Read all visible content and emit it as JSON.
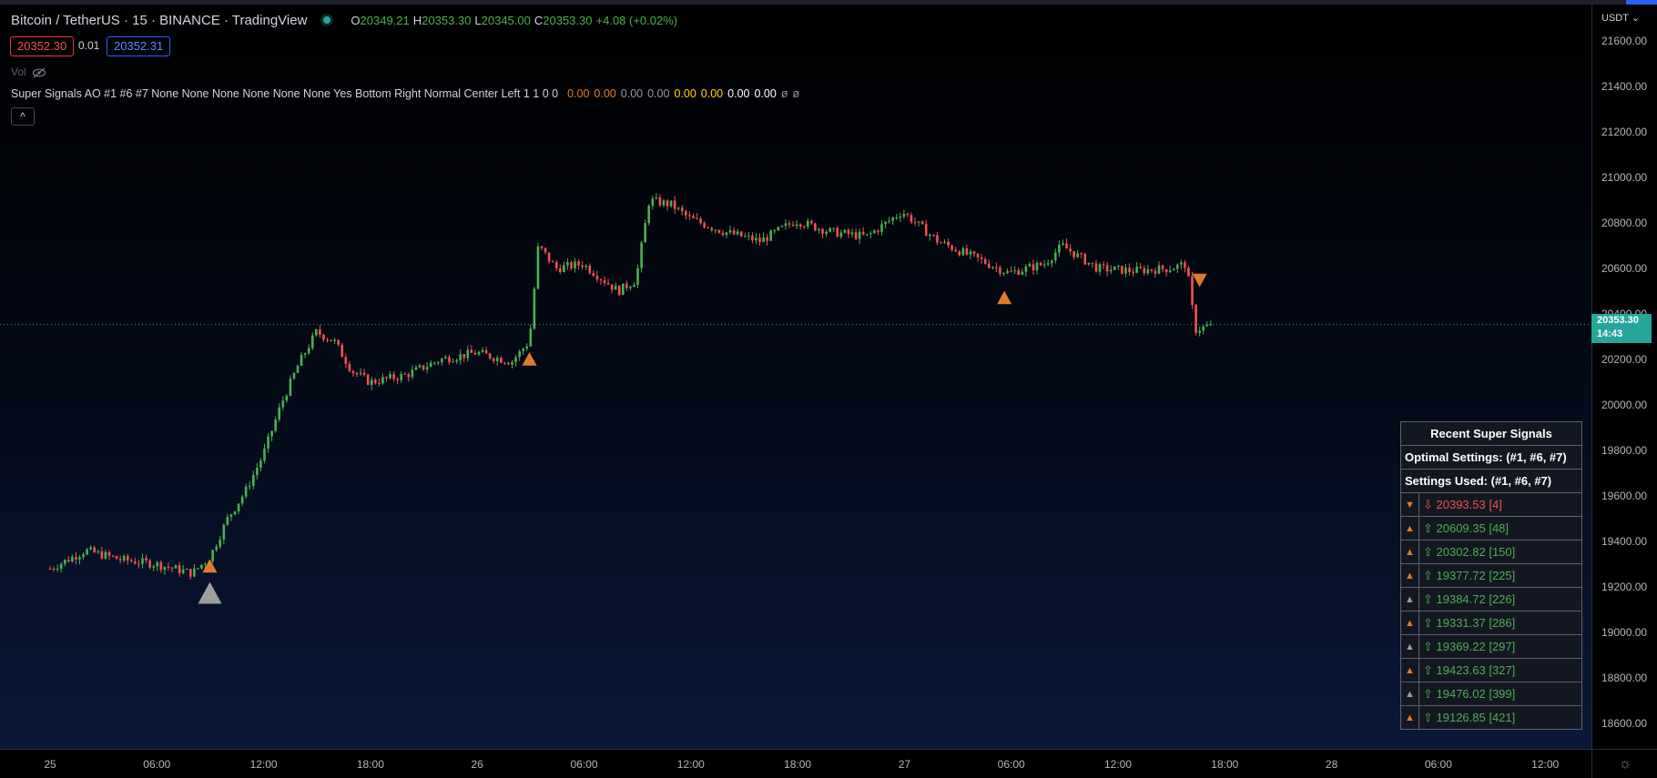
{
  "header": {
    "symbol": "Bitcoin / TetherUS · 15 · BINANCE · TradingView",
    "ohlc": [
      {
        "k": "O",
        "v": "20349.21"
      },
      {
        "k": "H",
        "v": "20353.30"
      },
      {
        "k": "L",
        "v": "20345.00"
      },
      {
        "k": "C",
        "v": "20353.30"
      }
    ],
    "change": "+4.08 (+0.02%)"
  },
  "trade": {
    "sell": "20352.30",
    "spread": "0.01",
    "buy": "20352.31"
  },
  "volume_label": "Vol",
  "indicator": {
    "name": "Super Signals AO #1 #6 #7 None None None None None None Yes Bottom Right Normal Center Left 1 1 0 0",
    "values": [
      {
        "v": "0.00",
        "c": "o"
      },
      {
        "v": "0.00",
        "c": "o"
      },
      {
        "v": "0.00",
        "c": "g"
      },
      {
        "v": "0.00",
        "c": "g"
      },
      {
        "v": "0.00",
        "c": "y"
      },
      {
        "v": "0.00",
        "c": "y"
      },
      {
        "v": "0.00",
        "c": "w"
      },
      {
        "v": "0.00",
        "c": "w"
      },
      {
        "v": "ø",
        "c": "g"
      },
      {
        "v": "ø",
        "c": "g"
      }
    ]
  },
  "price_axis": {
    "currency": "USDT",
    "ticks": [
      "21600.00",
      "21400.00",
      "21200.00",
      "21000.00",
      "20800.00",
      "20600.00",
      "20400.00",
      "20200.00",
      "20000.00",
      "19800.00",
      "19600.00",
      "19400.00",
      "19200.00",
      "19000.00",
      "18800.00",
      "18600.00"
    ],
    "last_price": "20353.30",
    "countdown": "14:43"
  },
  "time_axis": [
    "25",
    "06:00",
    "12:00",
    "18:00",
    "26",
    "06:00",
    "12:00",
    "18:00",
    "27",
    "06:00",
    "12:00",
    "18:00",
    "28",
    "06:00",
    "12:00"
  ],
  "colors": {
    "up": "#26a69a",
    "bar_up": "#4caf50",
    "bar_down": "#ef5350",
    "orange_signal": "#e07b2a",
    "grey_signal": "#9e9e9e",
    "last_price": "#26a69a"
  },
  "signal_table": {
    "title": "Recent Super Signals",
    "optimal": "Optimal Settings: (#1, #6, #7)",
    "used": "Settings Used: (#1, #6, #7)",
    "rows": [
      {
        "icon": "▼",
        "icon_color": "#e07b2a",
        "text": "⇩ 20393.53 [4]",
        "dir": "dn"
      },
      {
        "icon": "▲",
        "icon_color": "#e07b2a",
        "text": "⇧ 20609.35 [48]",
        "dir": "up"
      },
      {
        "icon": "▲",
        "icon_color": "#e07b2a",
        "text": "⇧ 20302.82 [150]",
        "dir": "up"
      },
      {
        "icon": "▲",
        "icon_color": "#e07b2a",
        "text": "⇧ 19377.72 [225]",
        "dir": "up"
      },
      {
        "icon": "▲",
        "icon_color": "#9e9e9e",
        "text": "⇧ 19384.72 [226]",
        "dir": "up"
      },
      {
        "icon": "▲",
        "icon_color": "#e07b2a",
        "text": "⇧ 19331.37 [286]",
        "dir": "up"
      },
      {
        "icon": "▲",
        "icon_color": "#9e9e9e",
        "text": "⇧ 19369.22 [297]",
        "dir": "up"
      },
      {
        "icon": "▲",
        "icon_color": "#e07b2a",
        "text": "⇧ 19423.63 [327]",
        "dir": "up"
      },
      {
        "icon": "▲",
        "icon_color": "#9e9e9e",
        "text": "⇧ 19476.02 [399]",
        "dir": "up"
      },
      {
        "icon": "▲",
        "icon_color": "#e07b2a",
        "text": "⇧ 19126.85 [421]",
        "dir": "up"
      }
    ]
  },
  "chart_data": {
    "type": "candlestick",
    "interval": "15",
    "ylim": [
      18500,
      21700
    ],
    "x_ticks": [
      "25",
      "06:00",
      "12:00",
      "18:00",
      "26",
      "06:00",
      "12:00",
      "18:00",
      "27",
      "06:00",
      "12:00",
      "18:00",
      "28",
      "06:00",
      "12:00"
    ],
    "last_price": 20353.3,
    "close_path": [
      [
        "25 00:00",
        19280
      ],
      [
        "25 02:00",
        19360
      ],
      [
        "25 04:00",
        19320
      ],
      [
        "25 06:00",
        19300
      ],
      [
        "25 08:00",
        19260
      ],
      [
        "25 09:00",
        19330
      ],
      [
        "25 10:00",
        19500
      ],
      [
        "25 11:00",
        19620
      ],
      [
        "25 12:00",
        19780
      ],
      [
        "25 13:00",
        20000
      ],
      [
        "25 14:00",
        20180
      ],
      [
        "25 15:00",
        20320
      ],
      [
        "25 16:00",
        20280
      ],
      [
        "25 17:00",
        20150
      ],
      [
        "25 18:00",
        20100
      ],
      [
        "25 20:00",
        20130
      ],
      [
        "25 22:00",
        20200
      ],
      [
        "26 00:00",
        20230
      ],
      [
        "26 02:00",
        20190
      ],
      [
        "26 03:00",
        20280
      ],
      [
        "26 03:30",
        20700
      ],
      [
        "26 04:30",
        20600
      ],
      [
        "26 06:00",
        20620
      ],
      [
        "26 08:00",
        20500
      ],
      [
        "26 09:00",
        20550
      ],
      [
        "26 09:45",
        20900
      ],
      [
        "26 11:00",
        20880
      ],
      [
        "26 12:00",
        20820
      ],
      [
        "26 14:00",
        20760
      ],
      [
        "26 16:00",
        20720
      ],
      [
        "26 18:00",
        20810
      ],
      [
        "26 20:00",
        20760
      ],
      [
        "26 22:00",
        20740
      ],
      [
        "27 00:00",
        20850
      ],
      [
        "27 02:00",
        20720
      ],
      [
        "27 04:00",
        20650
      ],
      [
        "27 06:00",
        20580
      ],
      [
        "27 08:00",
        20620
      ],
      [
        "27 09:00",
        20700
      ],
      [
        "27 11:00",
        20600
      ],
      [
        "27 13:00",
        20590
      ],
      [
        "27 15:00",
        20600
      ],
      [
        "27 16:00",
        20620
      ],
      [
        "27 16:30",
        20330
      ],
      [
        "27 17:30",
        20353
      ]
    ],
    "signals": [
      {
        "time": "25 09:00",
        "dir": "up",
        "color": "grey",
        "price": 19170,
        "size": "large"
      },
      {
        "time": "25 09:00",
        "dir": "up",
        "color": "orange",
        "price": 19290
      },
      {
        "time": "26 03:00",
        "dir": "up",
        "color": "orange",
        "price": 20200
      },
      {
        "time": "27 05:45",
        "dir": "up",
        "color": "orange",
        "price": 20470
      },
      {
        "time": "27 16:45",
        "dir": "down",
        "color": "orange",
        "price": 20550
      }
    ]
  }
}
